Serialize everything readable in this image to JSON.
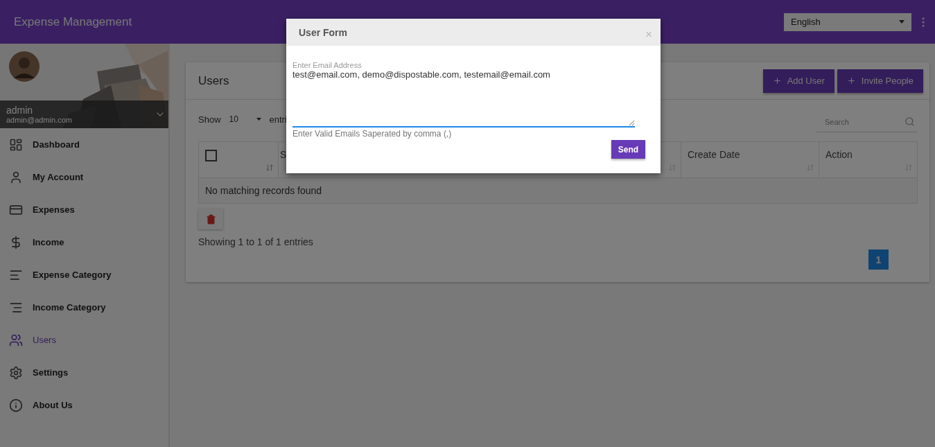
{
  "app": {
    "title": "Expense Management"
  },
  "language": {
    "value": "English"
  },
  "profile": {
    "name": "admin",
    "email": "admin@admin.com"
  },
  "sidebar": {
    "items": [
      {
        "label": "Dashboard",
        "selected": false
      },
      {
        "label": "My Account",
        "selected": false
      },
      {
        "label": "Expenses",
        "selected": false
      },
      {
        "label": "Income",
        "selected": false
      },
      {
        "label": "Expense Category",
        "selected": false
      },
      {
        "label": "Income Category",
        "selected": false
      },
      {
        "label": "Users",
        "selected": true
      },
      {
        "label": "Settings",
        "selected": false
      },
      {
        "label": "About Us",
        "selected": false
      }
    ]
  },
  "card": {
    "title": "Users",
    "buttons": [
      {
        "label": "Add User"
      },
      {
        "label": "Invite People"
      }
    ]
  },
  "table": {
    "length_label": "Show",
    "page_length": "10",
    "entries_label": "entri",
    "search": {
      "placeholder": "Search"
    },
    "columns": [
      {
        "kind": "checkbox",
        "checked": false
      },
      {
        "kind": "text",
        "label": "S"
      },
      {
        "kind": "text",
        "label": "Create Date"
      },
      {
        "kind": "text",
        "label": "Action"
      }
    ],
    "empty_message": "No matching records found",
    "info": "Showing 1 to 1 of 1 entries",
    "pagination": [
      {
        "label": "1",
        "selected": true
      }
    ]
  },
  "modal": {
    "title": "User Form",
    "close": "×",
    "field": {
      "label": "Enter Email Address",
      "value": "test@email.com, demo@dispostable.com, testemail@email.com",
      "help": "Enter Valid Emails Saperated by comma (,)"
    },
    "submit": "Send"
  }
}
